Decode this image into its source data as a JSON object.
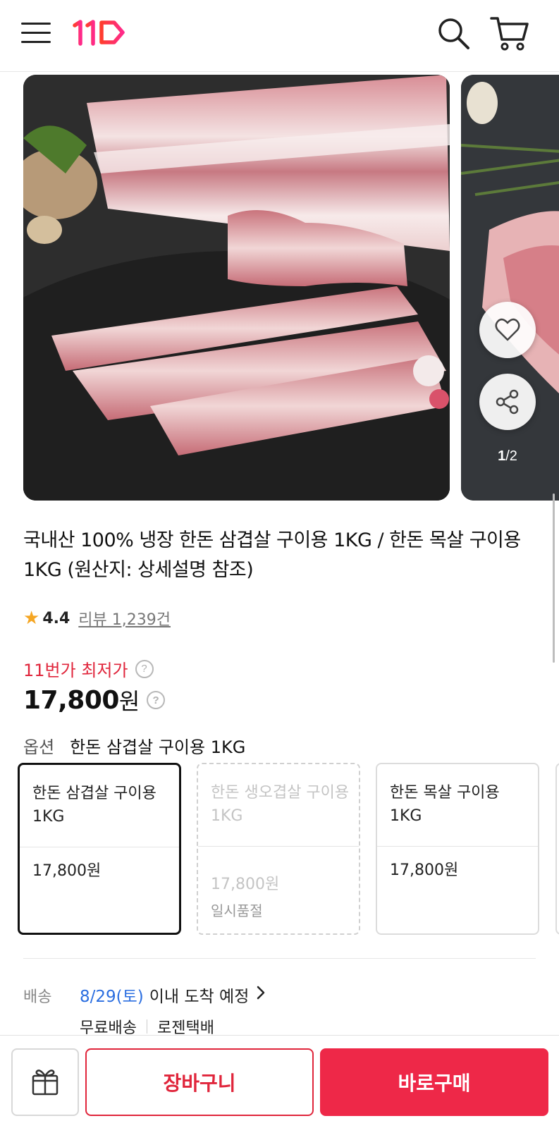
{
  "header": {
    "menu_icon": "hamburger-menu-icon",
    "logo_text": "11",
    "search_icon": "search-icon",
    "cart_icon": "cart-icon"
  },
  "gallery": {
    "current_page": "1",
    "separator": "/",
    "total_pages": "2",
    "favorite_icon": "heart-icon",
    "share_icon": "share-icon"
  },
  "product": {
    "title": "국내산 100% 냉장 한돈 삼겹살 구이용 1KG / 한돈 목살 구이용 1KG (원산지: 상세설명 참조)",
    "rating": "4.4",
    "reviews": "리뷰 1,239건",
    "price_label": "11번가 최저가",
    "price_amount": "17,800",
    "price_unit": "원"
  },
  "option": {
    "label": "옵션",
    "selected": "한돈 삼겹살 구이용 1KG",
    "cards": [
      {
        "name": "한돈 삼겹살 구이용 1KG",
        "price": "17,800원",
        "status": ""
      },
      {
        "name": "한돈 생오겹살 구이용 1KG",
        "price": "17,800원",
        "status": "일시품절"
      },
      {
        "name": "한돈 목살 구이용 1KG",
        "price": "17,800원",
        "status": ""
      }
    ]
  },
  "shipping": {
    "label": "배송",
    "date": "8/29(토)",
    "date_suffix": "이내 도착 예정",
    "free": "무료배송",
    "carrier": "로젠택배"
  },
  "bottom_bar": {
    "gift_icon": "gift-icon",
    "cart_label": "장바구니",
    "buy_label": "바로구매"
  },
  "colors": {
    "accent_red": "#ee2848",
    "price_label_red": "#e0253b",
    "date_blue": "#2b6ee0",
    "star": "#f5a623"
  }
}
